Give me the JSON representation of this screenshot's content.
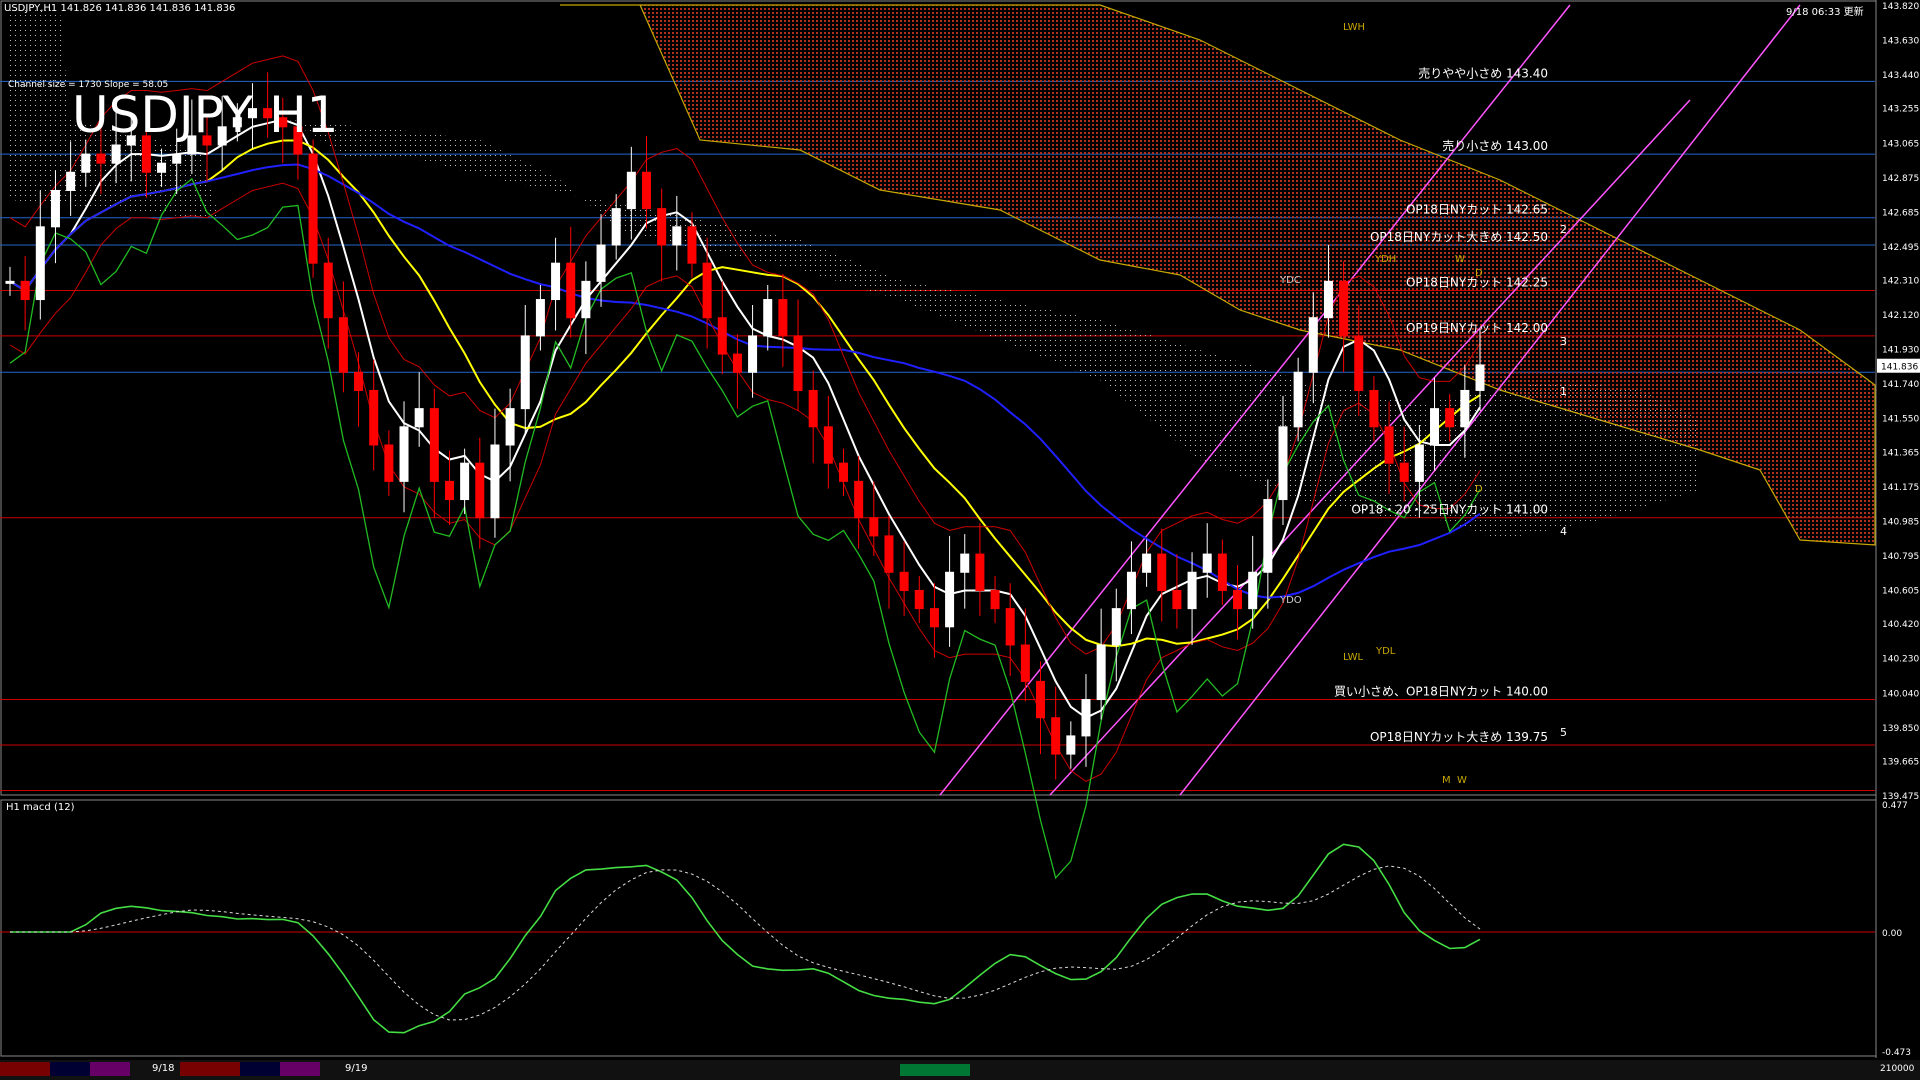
{
  "header": {
    "symbol_line": "USDJPY,H1  141.826 141.836 141.836 141.836",
    "channel_info": "Channel size = 1730 Slope = 58.05",
    "big_title": "USDJPY H1",
    "timestamp": "9/18 06:33 更新"
  },
  "price_axis": {
    "ticks": [
      "143.820",
      "143.630",
      "143.440",
      "143.255",
      "143.065",
      "142.875",
      "142.685",
      "142.495",
      "142.310",
      "142.120",
      "141.930",
      "141.740",
      "141.550",
      "141.365",
      "141.175",
      "140.985",
      "140.795",
      "140.605",
      "140.420",
      "140.230",
      "140.040",
      "139.850",
      "139.665",
      "139.475"
    ],
    "current_price": "141.836"
  },
  "labels": [
    {
      "text": "売りやや小さめ 143.40",
      "price": 143.4
    },
    {
      "text": "売り小さめ 143.00",
      "price": 143.0
    },
    {
      "text": "OP18日NYカット 142.65",
      "price": 142.65
    },
    {
      "text": "OP18日NYカット大きめ 142.50",
      "price": 142.5
    },
    {
      "text": "OP18日NYカット 142.25",
      "price": 142.25
    },
    {
      "text": "OP19日NYカット 142.00",
      "price": 142.0
    },
    {
      "text": "OP18・20・25日NYカット 141.00",
      "price": 141.0
    },
    {
      "text": "買い小さめ、OP18日NYカット 140.00",
      "price": 140.0
    },
    {
      "text": "OP18日NYカット大きめ 139.75",
      "price": 139.75
    }
  ],
  "box_labels": {
    "lwh": "LWH",
    "ydh": "YDH",
    "ydc": "YDC",
    "ydo": "YDO",
    "lwl": "LWL",
    "ydl": "YDL",
    "d": "D",
    "w": "W",
    "m": "M"
  },
  "channel_nums": [
    "1",
    "2",
    "3",
    "4",
    "5"
  ],
  "macd": {
    "title": "H1  macd (12)",
    "ticks": [
      "0.477",
      "0.00",
      "-0.473"
    ],
    "footer": "210000"
  },
  "dates": [
    "9/18",
    "9/19"
  ],
  "colors": {
    "bull": "#ffffff",
    "bear": "#ff0000",
    "ma_white": "#ffffff",
    "ma_yellow": "#ffff00",
    "ma_blue": "#2020ff",
    "bb": "#cc0000",
    "chikou": "#22bb22",
    "channel": "#ff55ff",
    "cloud_red": "#b03020",
    "grid_h": "#2266cc"
  },
  "chart_data": {
    "type": "candlestick",
    "symbol": "USDJPY",
    "timeframe": "H1",
    "ylim": [
      139.475,
      143.82
    ],
    "current": 141.836,
    "close_path": [
      142.3,
      142.2,
      142.6,
      142.8,
      142.9,
      143.0,
      142.95,
      143.05,
      143.1,
      142.9,
      142.95,
      143.0,
      143.1,
      143.05,
      143.15,
      143.2,
      143.25,
      143.2,
      143.15,
      143.0,
      142.4,
      142.1,
      141.8,
      141.7,
      141.4,
      141.2,
      141.5,
      141.6,
      141.2,
      141.1,
      141.3,
      141.0,
      141.4,
      141.6,
      142.0,
      142.2,
      142.4,
      142.1,
      142.3,
      142.5,
      142.7,
      142.9,
      142.7,
      142.5,
      142.6,
      142.4,
      142.1,
      141.9,
      141.8,
      142.0,
      142.2,
      142.0,
      141.7,
      141.5,
      141.3,
      141.2,
      141.0,
      140.9,
      140.7,
      140.6,
      140.5,
      140.4,
      140.7,
      140.8,
      140.6,
      140.5,
      140.3,
      140.1,
      139.9,
      139.7,
      139.8,
      140.0,
      140.3,
      140.5,
      140.7,
      140.8,
      140.6,
      140.5,
      140.7,
      140.8,
      140.6,
      140.5,
      140.7,
      141.1,
      141.5,
      141.8,
      142.1,
      142.3,
      142.0,
      141.7,
      141.5,
      141.3,
      141.2,
      141.4,
      141.6,
      141.5,
      141.7,
      141.84
    ]
  }
}
